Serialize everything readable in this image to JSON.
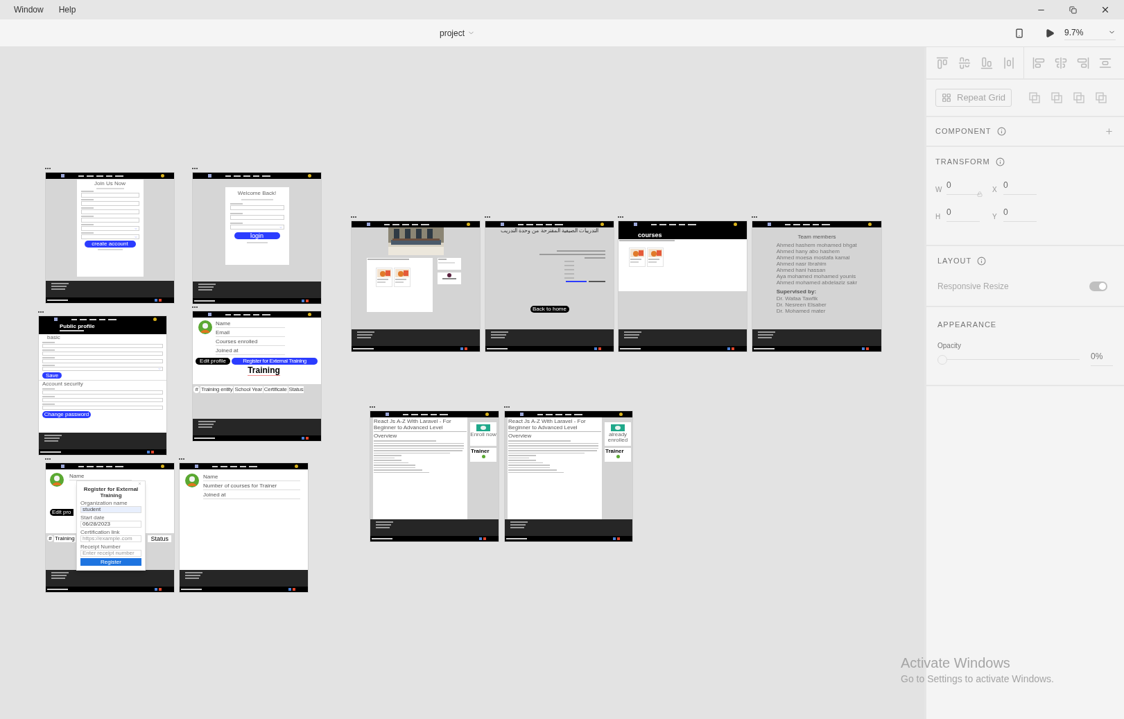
{
  "menu_bar": [
    {
      "label": "Window"
    },
    {
      "label": "Help"
    }
  ],
  "toolbar": {
    "document_title": "project",
    "zoom": "9.7%"
  },
  "artboards": [
    {
      "kind": "signup",
      "title": "Join Us Now",
      "button": "create account"
    },
    {
      "kind": "login",
      "title": "Welcome Back!",
      "button": "login"
    },
    {
      "kind": "edit_profile",
      "title": "Public profile",
      "sections": [
        "basic",
        "Account security"
      ],
      "buttons": [
        "Save",
        "Change password"
      ]
    },
    {
      "kind": "student_profile",
      "fields": [
        "Name",
        "Email",
        "Courses enrolled",
        "Joined at"
      ],
      "buttons": [
        "Edit profile",
        "Register for External Training"
      ],
      "heading": "Training",
      "columns": [
        "#",
        "Training entity",
        "School Year",
        "Certificate",
        "Status"
      ]
    },
    {
      "kind": "register_modal",
      "fields": [
        "Name"
      ],
      "button": "Edit pro",
      "columns": [
        "#",
        "Training",
        "Status"
      ],
      "modal": {
        "title": "Register for External Training",
        "inputs": [
          {
            "label": "Organization name",
            "value": "student"
          },
          {
            "label": "Start date",
            "value": "06/28/2023"
          },
          {
            "label": "Certification link",
            "placeholder": "https://example.com"
          },
          {
            "label": "Receipt Number",
            "placeholder": "Enter receipt number"
          }
        ],
        "button": "Register"
      }
    },
    {
      "kind": "trainer_profile",
      "fields": [
        "Name",
        "Number of courses for Trainer",
        "Joined at"
      ]
    },
    {
      "kind": "home"
    },
    {
      "kind": "arabic",
      "title": "التدريبات الصيفية المقترحة من وحدة التدريب",
      "button": "Back to home"
    },
    {
      "kind": "courses",
      "title": "courses"
    },
    {
      "kind": "team",
      "title": "Team members",
      "members": [
        "Ahmed hashem mohamed bhgat",
        "Ahmed hany abo hashem",
        "Ahmed moesa mostafa kamal",
        "Ahmed nasr Ibrahim",
        "Ahmed hani hassan",
        "Aya mohamed mohamed younis",
        "Ahmed mohamed abdelaziz sakr"
      ],
      "supervisor_title": "Supervised by:",
      "supervisors": [
        "Dr. Wafaa Tawfik",
        "Dr. Nesreen Elsaber",
        "Dr. Mohamed mater"
      ]
    },
    {
      "kind": "course_detail",
      "title": "React Js A-Z With Laravel - For Beginner to Advanced Level",
      "subtitle": "Overview",
      "cta": "Enroll now",
      "trainer": "Trainer"
    },
    {
      "kind": "course_detail",
      "title": "React Js A-Z With Laravel - For Beginner to Advanced Level",
      "subtitle": "Overview",
      "cta": "already enrolled",
      "trainer": "Trainer"
    }
  ],
  "properties": {
    "repeat_grid_button": "Repeat Grid",
    "component": {
      "title": "COMPONENT"
    },
    "transform": {
      "title": "TRANSFORM",
      "fields": [
        {
          "label": "W",
          "value": "0"
        },
        {
          "label": "X",
          "value": "0"
        },
        {
          "label": "H",
          "value": "0"
        },
        {
          "label": "Y",
          "value": "0"
        }
      ]
    },
    "layout": {
      "title": "LAYOUT",
      "responsive_resize": {
        "label": "Responsive Resize",
        "on": true,
        "disabled": true
      }
    },
    "appearance": {
      "title": "APPEARANCE",
      "opacity": {
        "label": "Opacity",
        "level": 0,
        "reading": "0%"
      }
    }
  },
  "os_notice": {
    "title": "Activate Windows",
    "subtitle": "Go to Settings to activate Windows."
  }
}
